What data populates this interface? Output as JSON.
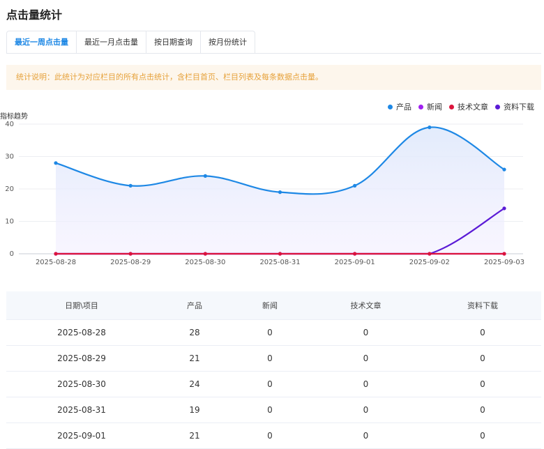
{
  "page": {
    "title": "点击量统计"
  },
  "tabs": [
    {
      "label": "最近一周点击量",
      "active": true
    },
    {
      "label": "最近一月点击量",
      "active": false
    },
    {
      "label": "按日期查询",
      "active": false
    },
    {
      "label": "按月份统计",
      "active": false
    }
  ],
  "notice": {
    "text": "统计说明：此统计为对应栏目的所有点击统计，含栏目首页、栏目列表及每条数据点击量。"
  },
  "chart_data": {
    "type": "line",
    "title": "",
    "ylabel": "指标趋势",
    "xlabel": "",
    "x": [
      "2025-08-28",
      "2025-08-29",
      "2025-08-30",
      "2025-08-31",
      "2025-09-01",
      "2025-09-02",
      "2025-09-03"
    ],
    "ylim": [
      0,
      40
    ],
    "yticks": [
      0,
      10,
      20,
      30,
      40
    ],
    "legend_position": "top-right",
    "grid": true,
    "smooth": true,
    "series": [
      {
        "name": "产品",
        "color": "#1e88e5",
        "area": true,
        "values": [
          28,
          21,
          24,
          19,
          21,
          39,
          26
        ]
      },
      {
        "name": "新闻",
        "color": "#a020f0",
        "area": false,
        "values": [
          0,
          0,
          0,
          0,
          0,
          0,
          0
        ]
      },
      {
        "name": "技术文章",
        "color": "#dc143c",
        "area": false,
        "values": [
          0,
          0,
          0,
          0,
          0,
          0,
          0
        ]
      },
      {
        "name": "资料下载",
        "color": "#5b1bd6",
        "area": false,
        "values": [
          0,
          0,
          0,
          0,
          0,
          0,
          14
        ]
      }
    ]
  },
  "table": {
    "headers": [
      "日期\\项目",
      "产品",
      "新闻",
      "技术文章",
      "资料下载"
    ],
    "rows": [
      [
        "2025-08-28",
        "28",
        "0",
        "0",
        "0"
      ],
      [
        "2025-08-29",
        "21",
        "0",
        "0",
        "0"
      ],
      [
        "2025-08-30",
        "24",
        "0",
        "0",
        "0"
      ],
      [
        "2025-08-31",
        "19",
        "0",
        "0",
        "0"
      ],
      [
        "2025-09-01",
        "21",
        "0",
        "0",
        "0"
      ]
    ]
  }
}
